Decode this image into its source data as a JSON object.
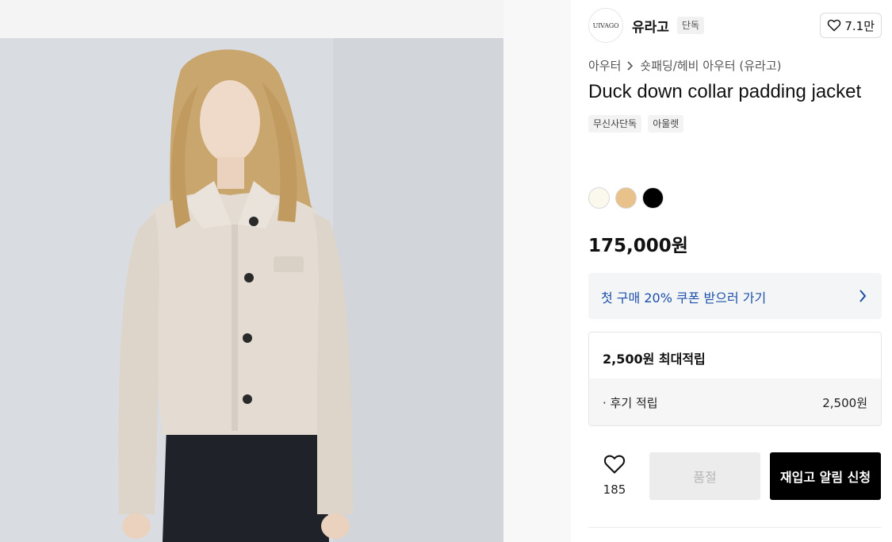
{
  "brand": {
    "logo_text": "UIVAGO",
    "name": "유라고",
    "badge": "단독"
  },
  "likes": {
    "count_label": "7.1만"
  },
  "breadcrumb": {
    "level1": "아우터",
    "level2": "숏패딩/헤비 아우터 (유라고)"
  },
  "product": {
    "title": "Duck down collar padding jacket",
    "tags": [
      "무신사단독",
      "아울렛"
    ],
    "price": "175,000원"
  },
  "swatches": [
    {
      "name": "ivory",
      "color": "#fbf8ee"
    },
    {
      "name": "beige",
      "color": "#e8c28a"
    },
    {
      "name": "black",
      "color": "#000000"
    }
  ],
  "coupon": {
    "label": "첫 구매 20% 쿠폰 받으러 가기"
  },
  "points": {
    "title": "2,500원 최대적립",
    "review_label": "· 후기 적립",
    "review_value": "2,500원"
  },
  "actions": {
    "wish_count": "185",
    "soldout_label": "품절",
    "restock_label": "재입고 알림 신청"
  },
  "colors": {
    "coupon_text": "#1b4fa8",
    "cta_bg": "#000000"
  }
}
